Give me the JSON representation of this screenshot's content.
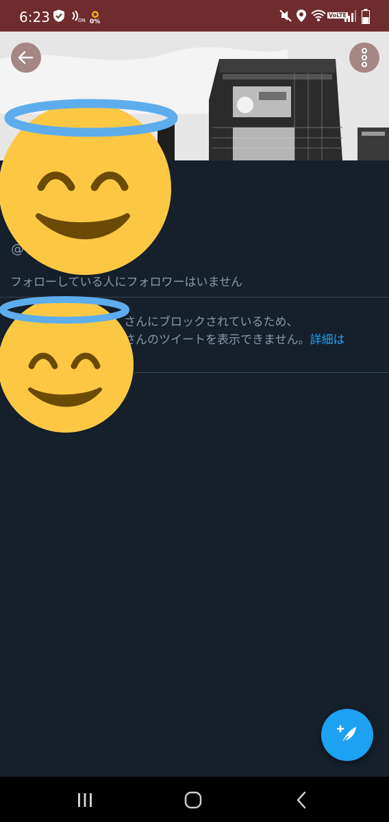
{
  "status_bar": {
    "time": "6:23",
    "data_saver_pct": "0%",
    "icons": [
      "shield-icon",
      "nfc-icon",
      "mute-icon",
      "location-icon",
      "wifi-icon",
      "volte-icon",
      "signal-icon",
      "battery-icon"
    ],
    "volte_label": "VoLTE"
  },
  "header": {
    "back_icon": "arrow-left-icon",
    "more_icon": "more-vertical-icon"
  },
  "profile": {
    "handle_prefix": "@",
    "followers_known": "フォローしている人にフォロワーはいません"
  },
  "blocked_notice": {
    "line1": "さんにブロックされているため、",
    "line2": "さんのツイートを表示できません。",
    "link": "詳細は"
  },
  "fab": {
    "icon": "compose-tweet-icon"
  },
  "nav_bar": {
    "items": [
      "recents-icon",
      "home-icon",
      "back-icon"
    ]
  },
  "colors": {
    "status_bar": "#6e2c2f",
    "background": "#15202b",
    "accent": "#1da1f2",
    "secondary_text": "#8899a6",
    "emoji_face": "#fcc844",
    "emoji_halo": "#5dadec"
  }
}
